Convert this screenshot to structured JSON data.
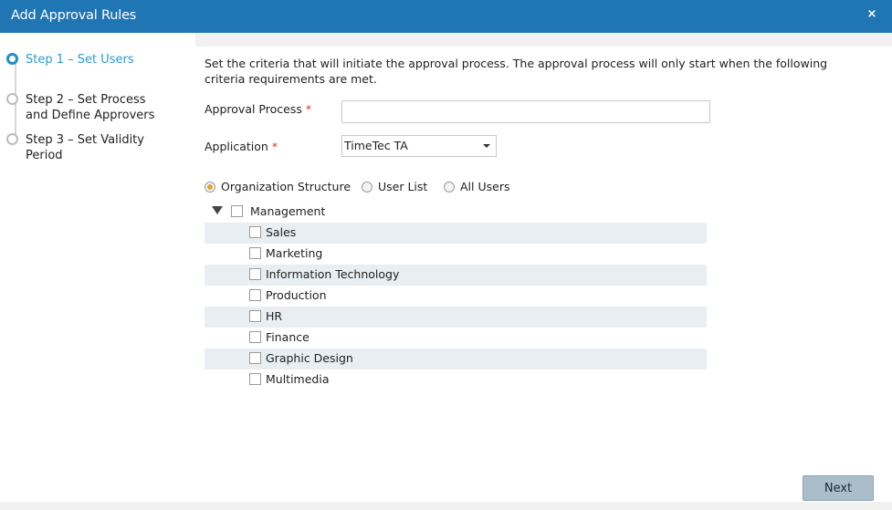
{
  "dialog": {
    "title": "Add Approval Rules",
    "close_glyph": "×"
  },
  "steps": [
    {
      "line1": "Step 1 – Set Users",
      "line2": "",
      "active": true
    },
    {
      "line1": "Step 2 – Set Process",
      "line2": "and Define Approvers",
      "active": false
    },
    {
      "line1": "Step 3 – Set Validity",
      "line2": "Period",
      "active": false
    }
  ],
  "form": {
    "intro": "Set the criteria that will initiate the approval process. The approval process will only start when the following criteria requirements are met.",
    "approval_process_label": "Approval Process",
    "approval_process_value": "",
    "required_mark": "*",
    "application_label": "Application",
    "application_value": "TimeTec TA"
  },
  "user_scope": {
    "options": [
      "Organization Structure",
      "User List",
      "All Users"
    ],
    "selected": "Organization Structure"
  },
  "tree": {
    "root": {
      "label": "Management",
      "expanded": true,
      "checked": false
    },
    "children": [
      {
        "label": "Sales",
        "checked": false
      },
      {
        "label": "Marketing",
        "checked": false
      },
      {
        "label": "Information Technology",
        "checked": false
      },
      {
        "label": "Production",
        "checked": false
      },
      {
        "label": "HR",
        "checked": false
      },
      {
        "label": "Finance",
        "checked": false
      },
      {
        "label": "Graphic Design",
        "checked": false
      },
      {
        "label": "Multimedia",
        "checked": false
      }
    ]
  },
  "footer": {
    "next_label": "Next"
  },
  "colors": {
    "titlebar": "#1f76b3",
    "active_step": "#2a9bd0",
    "required": "#d9342b",
    "radio_selected": "#e0a432",
    "row_alt": "#e8eef2"
  },
  "icons": {
    "close": "close-icon",
    "expand": "triangle-down-icon",
    "dropdown": "chevron-down-icon"
  }
}
